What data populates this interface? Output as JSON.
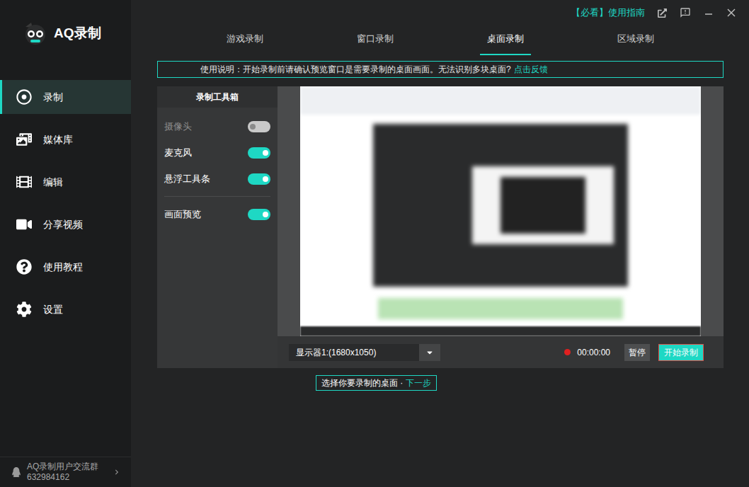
{
  "app": {
    "name": "AQ录制"
  },
  "header": {
    "guide": "【必看】使用指南"
  },
  "sidebar": {
    "items": [
      {
        "label": "录制",
        "selected": true
      },
      {
        "label": "媒体库",
        "selected": false
      },
      {
        "label": "编辑",
        "selected": false
      },
      {
        "label": "分享视频",
        "selected": false
      },
      {
        "label": "使用教程",
        "selected": false
      },
      {
        "label": "设置",
        "selected": false
      }
    ],
    "group": {
      "title": "AQ录制用户交流群",
      "number": "632984162"
    }
  },
  "tabs": [
    {
      "label": "游戏录制",
      "selected": false
    },
    {
      "label": "窗口录制",
      "selected": false
    },
    {
      "label": "桌面录制",
      "selected": true
    },
    {
      "label": "区域录制",
      "selected": false
    }
  ],
  "notice": {
    "text": "使用说明：开始录制前请确认预览窗口是需要录制的桌面画面。无法识别多块桌面?",
    "link": "点击反馈"
  },
  "toolbox": {
    "title": "录制工具箱",
    "groups": [
      [
        {
          "label": "摄像头",
          "on": false,
          "disabled": true
        },
        {
          "label": "麦克风",
          "on": true,
          "disabled": false
        },
        {
          "label": "悬浮工具条",
          "on": true,
          "disabled": false
        }
      ],
      [
        {
          "label": "画面预览",
          "on": true,
          "disabled": false
        }
      ]
    ]
  },
  "controls": {
    "display": "显示器1:(1680x1050)",
    "time": "00:00:00",
    "pause": "暂停",
    "start": "开始录制"
  },
  "hint": {
    "text": "选择你要录制的桌面 · ",
    "link": "下一步"
  }
}
